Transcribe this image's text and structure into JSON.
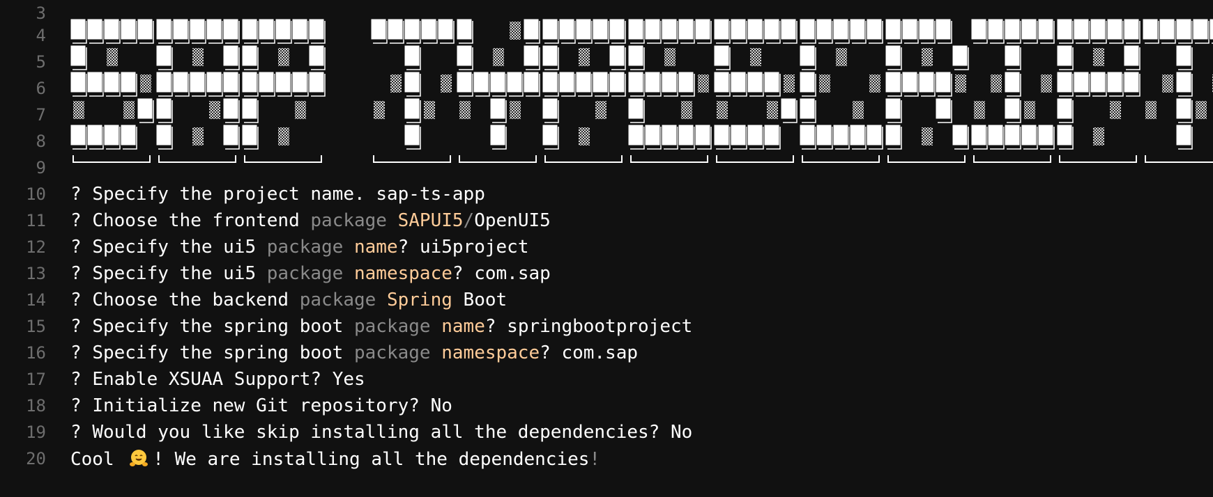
{
  "banner": {
    "word1": "SAP",
    "word2": "TYPESCRIPT",
    "rows": 6
  },
  "line_numbers": [
    "3",
    "4",
    "5",
    "6",
    "7",
    "8",
    "9",
    "10",
    "11",
    "12",
    "13",
    "14",
    "15",
    "16",
    "17",
    "18",
    "19",
    "20"
  ],
  "lines": {
    "l10": {
      "q": "? ",
      "t1": "Specify the project name. ",
      "v": "sap-ts-app"
    },
    "l11": {
      "q": "? ",
      "t1": "Choose the frontend ",
      "kw": "package",
      "sp": " ",
      "hl": "SAPUI5",
      "slash": "/",
      "v": "OpenUI5"
    },
    "l12": {
      "q": "? ",
      "t1": "Specify the ui5 ",
      "kw": "package",
      "sp": " ",
      "hl": "name",
      "t2": "? ",
      "v": "ui5project"
    },
    "l13": {
      "q": "? ",
      "t1": "Specify the ui5 ",
      "kw": "package",
      "sp": " ",
      "hl": "namespace",
      "t2": "? ",
      "v": "com.sap"
    },
    "l14": {
      "q": "? ",
      "t1": "Choose the backend ",
      "kw": "package",
      "sp": " ",
      "hl": "Spring",
      "t2": " ",
      "v": "Boot"
    },
    "l15": {
      "q": "? ",
      "t1": "Specify the spring boot ",
      "kw": "package",
      "sp": " ",
      "hl": "name",
      "t2": "? ",
      "v": "springbootproject"
    },
    "l16": {
      "q": "? ",
      "t1": "Specify the spring boot ",
      "kw": "package",
      "sp": " ",
      "hl": "namespace",
      "t2": "? ",
      "v": "com.sap"
    },
    "l17": {
      "q": "? ",
      "t1": "Enable XSUAA Support? ",
      "v": "Yes"
    },
    "l18": {
      "q": "? ",
      "t1": "Initialize new Git repository? ",
      "v": "No"
    },
    "l19": {
      "q": "? ",
      "t1": "Would you like skip installing all the dependencies? ",
      "v": "No"
    },
    "l20": {
      "t1": "Cool ",
      "emoji": "hugging-face-emoji",
      "t2": "! We are installing all the dependencies",
      "end": "!"
    }
  },
  "colors": {
    "background": "#111111",
    "line_number": "#6e6e6e",
    "keyword": "#8a8a8a",
    "highlight": "#ffcc99",
    "text": "#ffffff"
  }
}
